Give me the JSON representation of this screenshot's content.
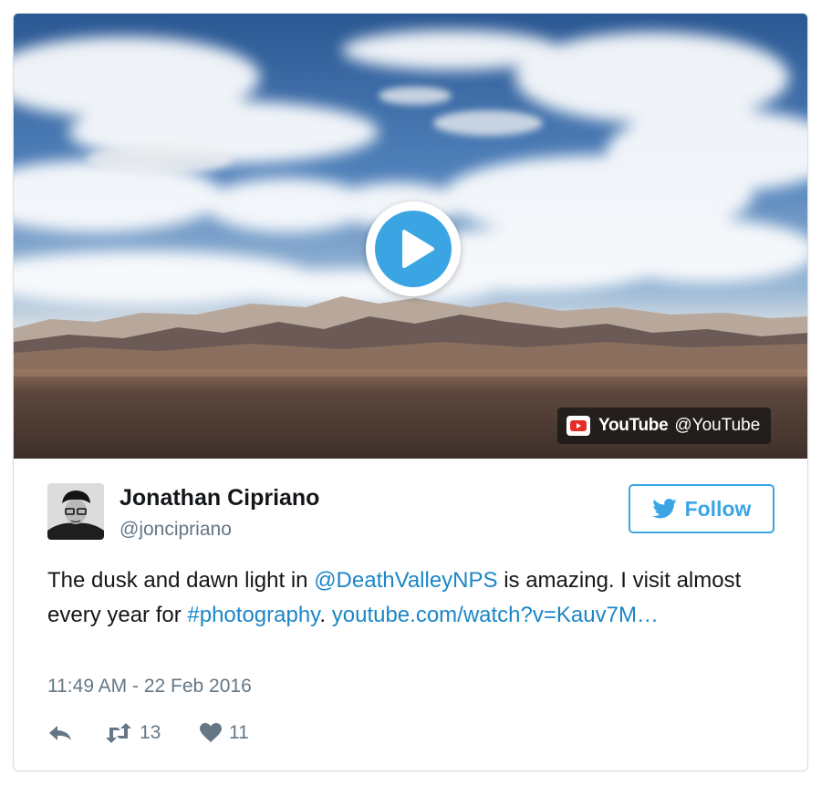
{
  "video": {
    "provider_brand": "YouTube",
    "provider_handle": "@YouTube",
    "play_icon": "play-icon",
    "provider_icon": "youtube-logo-icon"
  },
  "tweet": {
    "author": {
      "display_name": "Jonathan Cipriano",
      "screen_name": "@joncipriano",
      "avatar_icon": "avatar"
    },
    "follow_label": "Follow",
    "follow_icon": "twitter-bird-icon",
    "text": {
      "part1": "The dusk and dawn light in ",
      "mention": "@DeathValleyNPS",
      "part2": " is amazing. I visit almost every year for ",
      "hashtag": "#photography",
      "part3": ". ",
      "link": "youtube.com/watch?v=Kauv7M…"
    },
    "timestamp": "11:49 AM - 22 Feb 2016",
    "actions": {
      "reply_icon": "reply-icon",
      "retweet_icon": "retweet-icon",
      "retweet_count": "13",
      "like_icon": "heart-icon",
      "like_count": "11"
    }
  },
  "colors": {
    "accent": "#3ba5e4",
    "link": "#1b86c7",
    "text": "#14171a",
    "muted": "#657786",
    "youtube_red": "#e52d27"
  }
}
